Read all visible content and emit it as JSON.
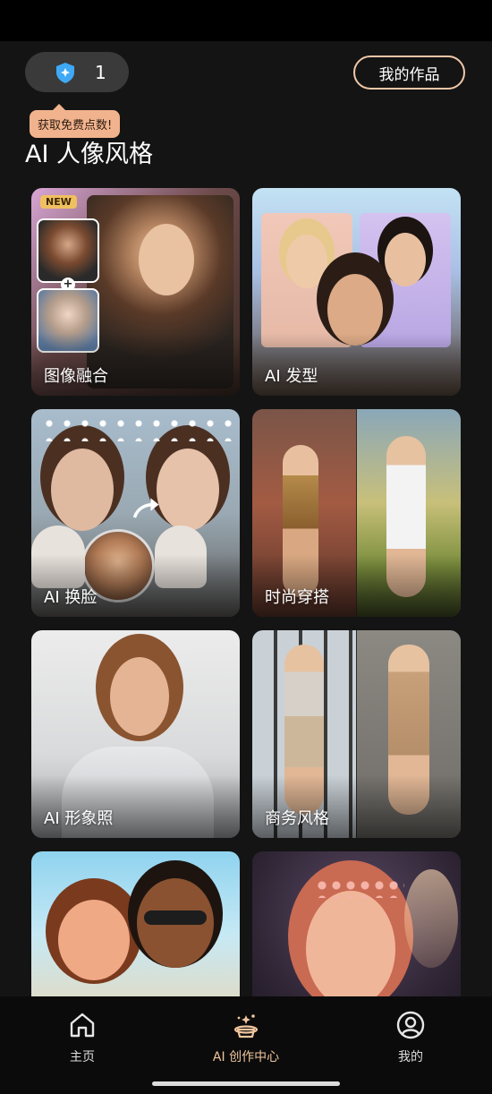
{
  "header": {
    "points_count": "1",
    "tooltip_text": "获取免费点数!",
    "my_works_label": "我的作品"
  },
  "section": {
    "title": "AI 人像风格"
  },
  "cards": [
    {
      "label": "图像融合",
      "badge": "NEW"
    },
    {
      "label": "AI 发型"
    },
    {
      "label": "AI 换脸"
    },
    {
      "label": "时尚穿搭"
    },
    {
      "label": "AI 形象照"
    },
    {
      "label": "商务风格"
    },
    {
      "label": ""
    },
    {
      "label": ""
    }
  ],
  "tabbar": {
    "items": [
      {
        "label": "主页",
        "icon": "home-icon"
      },
      {
        "label": "AI 创作中心",
        "icon": "magic-hat-icon"
      },
      {
        "label": "我的",
        "icon": "profile-icon"
      }
    ]
  },
  "colors": {
    "accent": "#f1c69e",
    "tooltip": "#f1b38d",
    "background": "#141414"
  }
}
